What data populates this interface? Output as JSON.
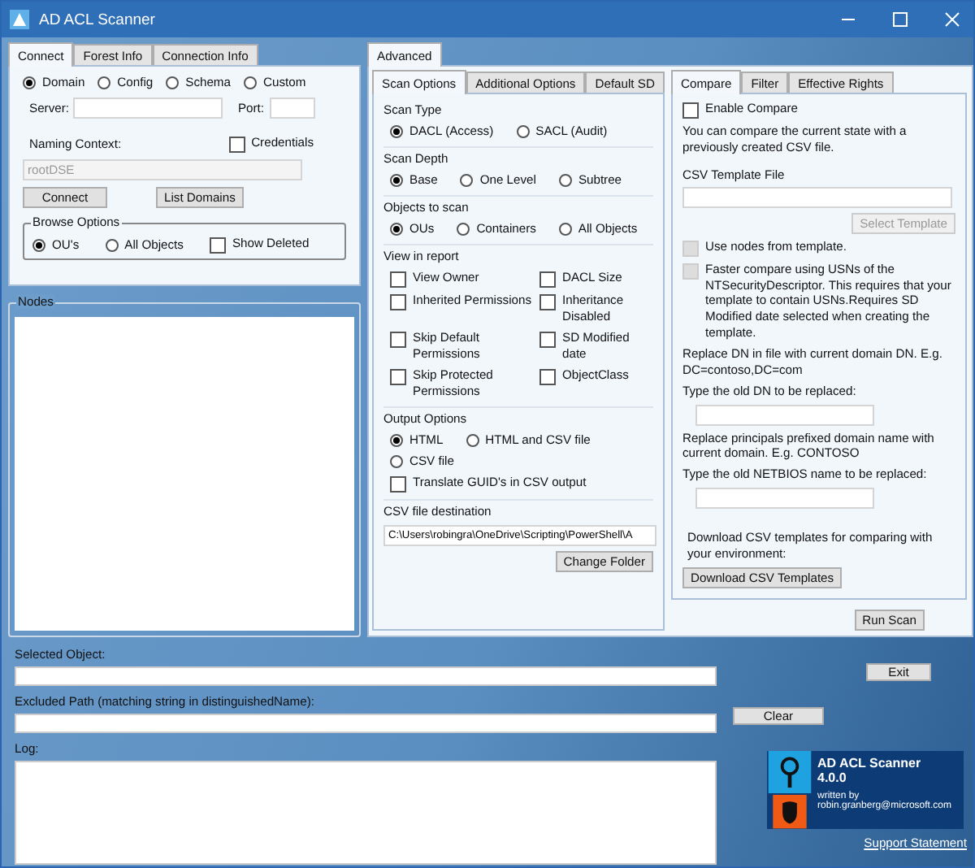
{
  "window": {
    "title": "AD ACL Scanner"
  },
  "left_tabs": [
    {
      "label": "Connect",
      "selected": true
    },
    {
      "label": "Forest Info",
      "selected": false
    },
    {
      "label": "Connection Info",
      "selected": false
    }
  ],
  "connect": {
    "scopes": [
      {
        "kind": "radio",
        "label": "Domain",
        "selected": true
      },
      {
        "kind": "radio",
        "label": "Config",
        "selected": false
      },
      {
        "kind": "radio",
        "label": "Schema",
        "selected": false
      },
      {
        "kind": "radio",
        "label": "Custom",
        "selected": false
      }
    ],
    "server": {
      "label": "Server:"
    },
    "port": {
      "label": "Port:"
    },
    "naming_context": {
      "label": "Naming Context:",
      "value": "rootDSE",
      "disabled": true
    },
    "credentials": {
      "kind": "checkbox",
      "label": "Credentials",
      "checked": false
    },
    "buttons": [
      {
        "label": "Connect"
      },
      {
        "label": "List Domains"
      }
    ],
    "browse_options": {
      "title": "Browse Options",
      "items": [
        {
          "kind": "radio",
          "label": "OU's",
          "selected": true
        },
        {
          "kind": "radio",
          "label": "All Objects",
          "selected": false
        },
        {
          "kind": "checkbox",
          "label": "Show Deleted",
          "checked": false
        }
      ]
    }
  },
  "nodes": {
    "title": "Nodes"
  },
  "advanced_tabs": [
    {
      "label": "Advanced",
      "selected": true
    }
  ],
  "scan_tabs": [
    {
      "label": "Scan Options",
      "selected": true
    },
    {
      "label": "Additional Options",
      "selected": false
    },
    {
      "label": "Default SD",
      "selected": false
    }
  ],
  "scan_sections": [
    {
      "title": "Scan Type",
      "rows": [
        [
          {
            "kind": "radio",
            "label": "DACL (Access)",
            "selected": true
          },
          {
            "kind": "radio",
            "label": "SACL (Audit)",
            "selected": false
          }
        ]
      ]
    },
    {
      "title": "Scan Depth",
      "rows": [
        [
          {
            "kind": "radio",
            "label": "Base",
            "selected": true
          },
          {
            "kind": "radio",
            "label": "One Level",
            "selected": false
          },
          {
            "kind": "radio",
            "label": "Subtree",
            "selected": false
          }
        ]
      ]
    },
    {
      "title": "Objects to scan",
      "rows": [
        [
          {
            "kind": "radio",
            "label": "OUs",
            "selected": true
          },
          {
            "kind": "radio",
            "label": "Containers",
            "selected": false
          },
          {
            "kind": "radio",
            "label": "All Objects",
            "selected": false
          }
        ]
      ]
    },
    {
      "title": "View in report",
      "rows": [
        [
          {
            "kind": "checkbox",
            "label": "View Owner",
            "checked": false
          },
          {
            "kind": "checkbox",
            "label": "DACL Size",
            "checked": false
          }
        ],
        [
          {
            "kind": "checkbox",
            "label": "Inherited Permissions",
            "checked": false
          },
          {
            "kind": "checkbox",
            "label": "Inheritance Disabled",
            "checked": false
          }
        ],
        [
          {
            "kind": "checkbox",
            "label": "Skip Default Permissions",
            "checked": false
          },
          {
            "kind": "checkbox",
            "label": "SD Modified date",
            "checked": false
          }
        ],
        [
          {
            "kind": "checkbox",
            "label": "Skip Protected Permissions",
            "checked": false
          },
          {
            "kind": "checkbox",
            "label": "ObjectClass",
            "checked": false
          }
        ]
      ]
    },
    {
      "title": "Output Options",
      "rows": [
        [
          {
            "kind": "radio",
            "label": "HTML",
            "selected": true
          },
          {
            "kind": "radio",
            "label": "HTML and CSV file",
            "selected": false
          }
        ],
        [
          {
            "kind": "radio",
            "label": "CSV file",
            "selected": false
          }
        ],
        [
          {
            "kind": "checkbox",
            "label": "Translate GUID's in CSV output",
            "checked": false
          }
        ]
      ]
    }
  ],
  "csv_destination": {
    "label": "CSV file destination",
    "value": "C:\\Users\\robingra\\OneDrive\\Scripting\\PowerShell\\A",
    "button": "Change Folder"
  },
  "compare_tabs": [
    {
      "label": "Compare",
      "selected": true
    },
    {
      "label": "Filter",
      "selected": false
    },
    {
      "label": "Effective Rights",
      "selected": false
    }
  ],
  "compare_items": [
    {
      "kind": "checkbox",
      "label": "Enable Compare",
      "checked": false,
      "disabled": false
    },
    {
      "kind": "text",
      "text": "You can compare the current state with a previously created CSV file."
    },
    {
      "kind": "label",
      "text": "CSV Template File"
    },
    {
      "kind": "field"
    },
    {
      "kind": "button",
      "label": "Select Template",
      "disabled": true
    },
    {
      "kind": "checkbox",
      "label": "Use nodes from template.",
      "checked": false,
      "disabled": true
    },
    {
      "kind": "checkbox",
      "label": "Faster compare using USNs of the NTSecurityDescriptor. This requires that your template to contain USNs.Requires SD Modified date selected when creating the template.",
      "checked": false,
      "disabled": true
    },
    {
      "kind": "text",
      "text": "Replace DN in file with current domain DN. E.g. DC=contoso,DC=com"
    },
    {
      "kind": "text",
      "text": "Type the old DN to be replaced:"
    },
    {
      "kind": "field"
    },
    {
      "kind": "text",
      "text": "Replace principals prefixed domain name with current domain. E.g. CONTOSO"
    },
    {
      "kind": "text",
      "text": "Type the old NETBIOS name to be replaced:"
    },
    {
      "kind": "field"
    },
    {
      "kind": "note",
      "text": "Download CSV templates for comparing with your environment:"
    },
    {
      "kind": "button",
      "label": "Download CSV Templates",
      "disabled": false
    }
  ],
  "run_scan": "Run Scan",
  "selected_object": {
    "label": "Selected Object:"
  },
  "exit": "Exit",
  "excluded_path": {
    "label": "Excluded Path (matching string in distinguishedName):"
  },
  "clear": "Clear",
  "log": {
    "label": "Log:"
  },
  "about": {
    "name": "AD ACL Scanner",
    "version": "4.0.0",
    "written_by": "written by",
    "email": "robin.granberg@microsoft.com"
  },
  "support_link": "Support Statement"
}
